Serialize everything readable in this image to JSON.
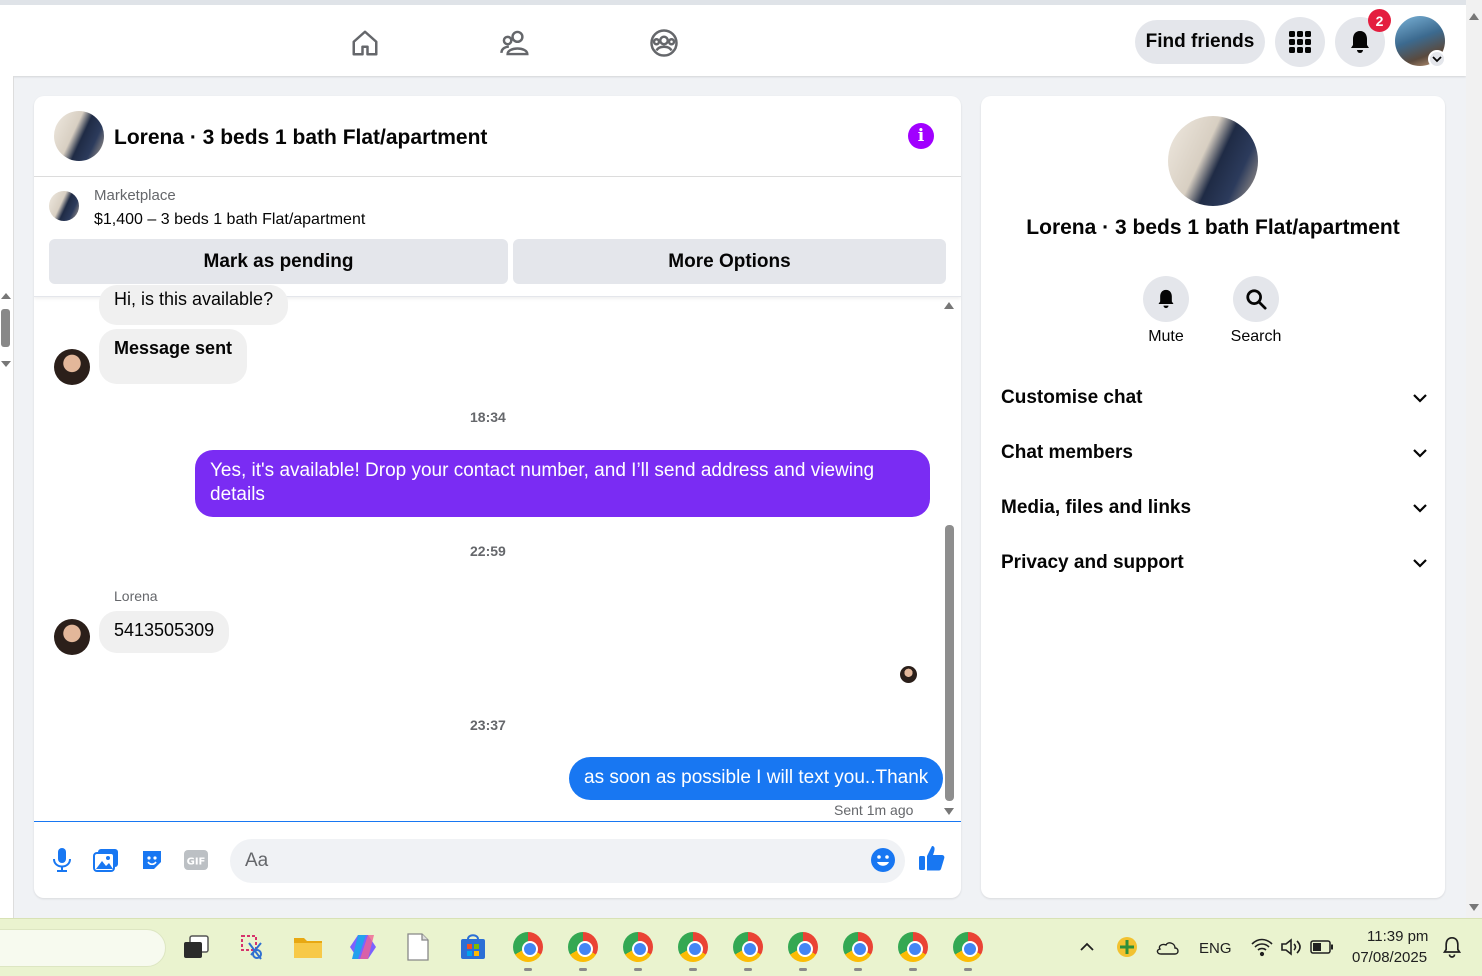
{
  "topbar": {
    "find_friends": "Find friends",
    "notification_count": "2"
  },
  "chat": {
    "title": "Lorena · 3 beds 1 bath Flat/apartment",
    "marketplace": {
      "label": "Marketplace",
      "listing": "$1,400 – 3 beds 1 bath Flat/apartment",
      "mark_pending": "Mark as pending",
      "more_options": "More Options"
    },
    "messages": {
      "first_in": "Hi, is this available?",
      "second_in": "Message sent",
      "time1": "18:34",
      "out1": "Yes, it's available! Drop your contact number, and I’ll send address and viewing details",
      "time2": "22:59",
      "sender_name": "Lorena",
      "phone": "5413505309",
      "time3": "23:37",
      "out2": "as soon as possible I will text you..Thank",
      "sent_status": "Sent 1m ago"
    },
    "composer": {
      "placeholder": "Aa"
    }
  },
  "info_panel": {
    "name": "Lorena · 3 beds 1 bath Flat/apartment",
    "mute": "Mute",
    "search": "Search",
    "sections": [
      "Customise chat",
      "Chat members",
      "Media, files and links",
      "Privacy and support"
    ]
  },
  "taskbar": {
    "language": "ENG",
    "time": "11:39 pm",
    "date": "07/08/2025"
  },
  "colors": {
    "accent_purple": "#7a2cf3",
    "accent_blue": "#1877f2",
    "info_purple": "#a100ff",
    "badge_red": "#e41e3f"
  }
}
